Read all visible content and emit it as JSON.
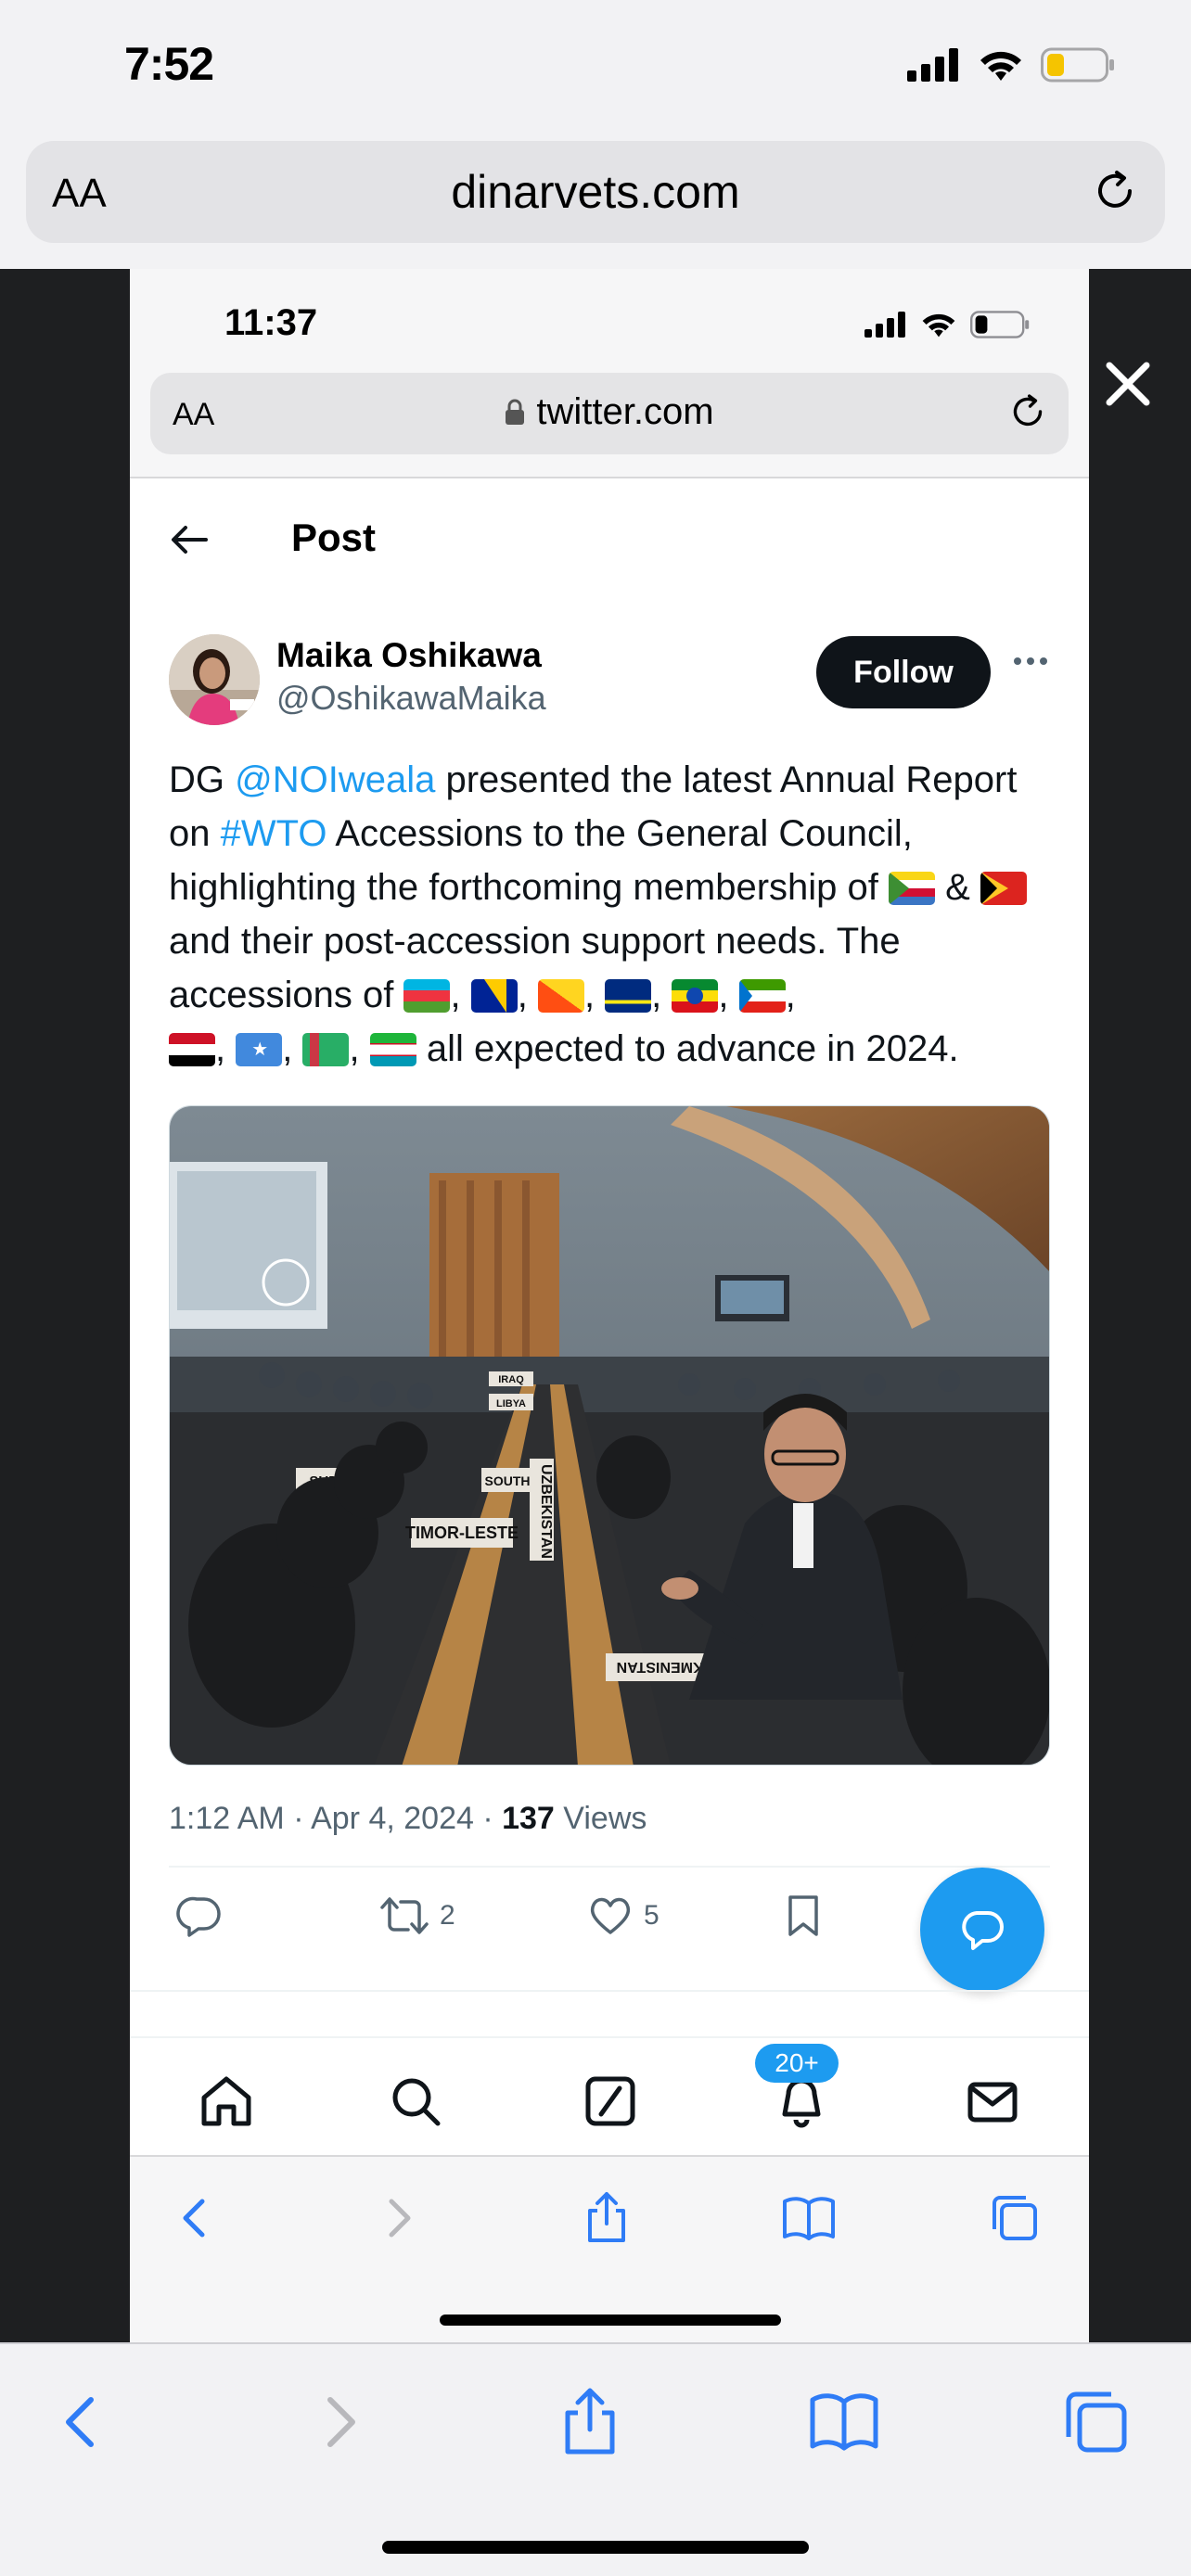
{
  "outer": {
    "time": "7:52",
    "aa_label": "AA",
    "domain": "dinarvets.com"
  },
  "inner": {
    "time": "11:37",
    "aa_label": "AA",
    "domain": "twitter.com"
  },
  "post": {
    "header_title": "Post",
    "author_name": "Maika Oshikawa",
    "author_handle": "@OshikawaMaika",
    "follow_label": "Follow",
    "text": {
      "p1": "DG ",
      "mention": "@NOIweala",
      "p2": " presented the latest Annual Report on ",
      "hashtag": "#WTO",
      "p3": " Accessions to the General Council, highlighting the forthcoming membership of ",
      "amp": " & ",
      "p4": " and their post-accession support needs.  The accessions of ",
      "p5": " all expected to advance in 2024."
    },
    "flags_first": [
      "comoros-flag",
      "timor-leste-flag"
    ],
    "flags_second": [
      "azerbaijan-flag",
      "bosnia-flag",
      "bhutan-flag",
      "curacao-flag",
      "ethiopia-flag",
      "equatorial-guinea-flag",
      "iraq-flag",
      "somalia-flag",
      "turkmenistan-flag",
      "uzbekistan-flag"
    ],
    "photo_labels": {
      "sudan": "SUDAN",
      "south": "SOUTH",
      "timor": "TIMOR-LESTE",
      "uzbekistan": "UZBEKISTAN",
      "turkmenistan": "TURKMENISTAN",
      "libya": "LIBYA",
      "iraq": "IRAQ"
    },
    "time": "1:12 AM",
    "date": "Apr 4, 2024",
    "views_count": "137",
    "views_label": "Views",
    "dot": " · ",
    "retweets": "2",
    "likes": "5"
  },
  "nav": {
    "notifications_badge": "20+"
  },
  "colors": {
    "link": "#1d9bf0",
    "follow_bg": "#0f1419",
    "muted": "#536471",
    "safari_blue": "#2f7cf6"
  }
}
